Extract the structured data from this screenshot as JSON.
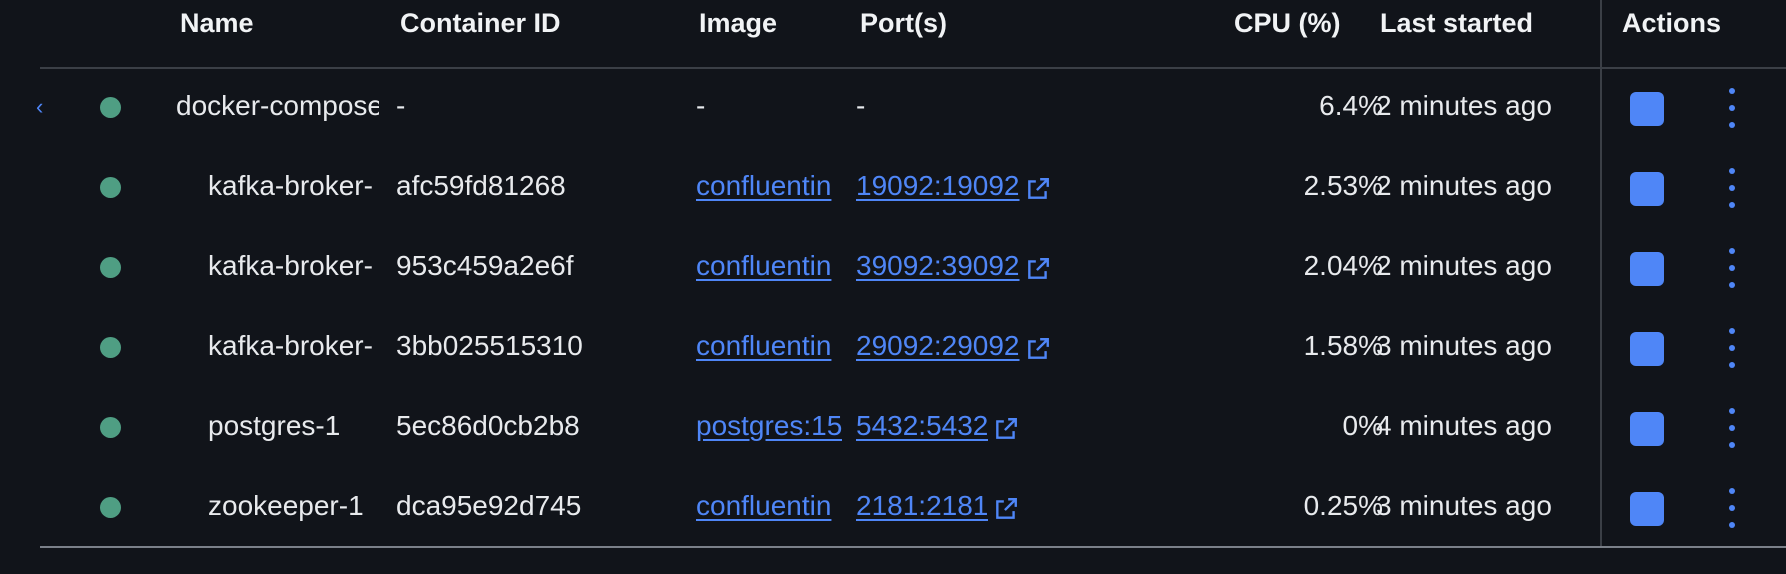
{
  "columns": {
    "name": "Name",
    "container_id": "Container ID",
    "image": "Image",
    "ports": "Port(s)",
    "cpu": "CPU (%)",
    "last_started": "Last started",
    "actions": "Actions"
  },
  "rows": [
    {
      "name": "docker-compose",
      "container_id": "-",
      "image": "-",
      "ports": "-",
      "cpu": "6.4%",
      "last_started": "2 minutes ago",
      "status": "running"
    },
    {
      "name": "kafka-broker-",
      "container_id": "afc59fd81268",
      "image": "confluentin",
      "ports": "19092:19092",
      "cpu": "2.53%",
      "last_started": "2 minutes ago",
      "status": "running"
    },
    {
      "name": "kafka-broker-",
      "container_id": "953c459a2e6f",
      "image": "confluentin",
      "ports": "39092:39092",
      "cpu": "2.04%",
      "last_started": "2 minutes ago",
      "status": "running"
    },
    {
      "name": "kafka-broker-",
      "container_id": "3bb025515310",
      "image": "confluentin",
      "ports": "29092:29092",
      "cpu": "1.58%",
      "last_started": "3 minutes ago",
      "status": "running"
    },
    {
      "name": "postgres-1",
      "container_id": "5ec86d0cb2b8",
      "image": "postgres:15",
      "ports": "5432:5432",
      "cpu": "0%",
      "last_started": "4 minutes ago",
      "status": "running"
    },
    {
      "name": "zookeeper-1",
      "container_id": "dca95e92d745",
      "image": "confluentin",
      "ports": "2181:2181",
      "cpu": "0.25%",
      "last_started": "3 minutes ago",
      "status": "running"
    }
  ],
  "colors": {
    "background": "#11141a",
    "accent": "#4f86f7",
    "running": "#4f9e83"
  }
}
